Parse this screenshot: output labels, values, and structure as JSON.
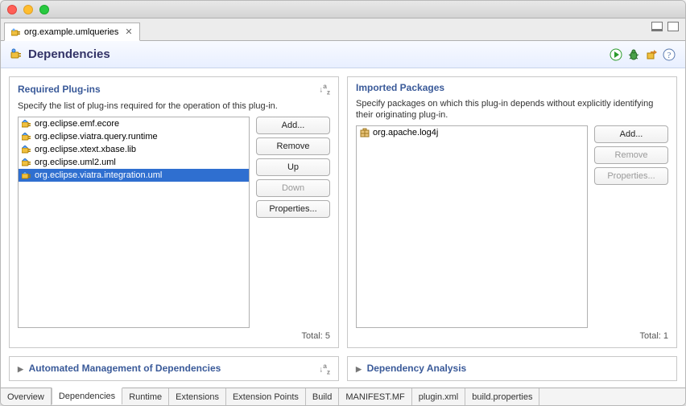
{
  "window": {
    "tab_title": "org.example.umlqueries"
  },
  "header": {
    "title": "Dependencies"
  },
  "required": {
    "title": "Required Plug-ins",
    "desc": "Specify the list of plug-ins required for the operation of this plug-in.",
    "items": [
      "org.eclipse.emf.ecore",
      "org.eclipse.viatra.query.runtime",
      "org.eclipse.xtext.xbase.lib",
      "org.eclipse.uml2.uml",
      "org.eclipse.viatra.integration.uml"
    ],
    "selected_index": 4,
    "buttons": {
      "add": "Add...",
      "remove": "Remove",
      "up": "Up",
      "down": "Down",
      "properties": "Properties..."
    },
    "total_label": "Total: 5"
  },
  "imported": {
    "title": "Imported Packages",
    "desc": "Specify packages on which this plug-in depends without explicitly identifying their originating plug-in.",
    "items": [
      "org.apache.log4j"
    ],
    "buttons": {
      "add": "Add...",
      "remove": "Remove",
      "properties": "Properties..."
    },
    "total_label": "Total: 1"
  },
  "collapsed_sections": {
    "auto": "Automated Management of Dependencies",
    "analysis": "Dependency Analysis"
  },
  "bottom_tabs": [
    "Overview",
    "Dependencies",
    "Runtime",
    "Extensions",
    "Extension Points",
    "Build",
    "MANIFEST.MF",
    "plugin.xml",
    "build.properties"
  ],
  "bottom_active_index": 1
}
